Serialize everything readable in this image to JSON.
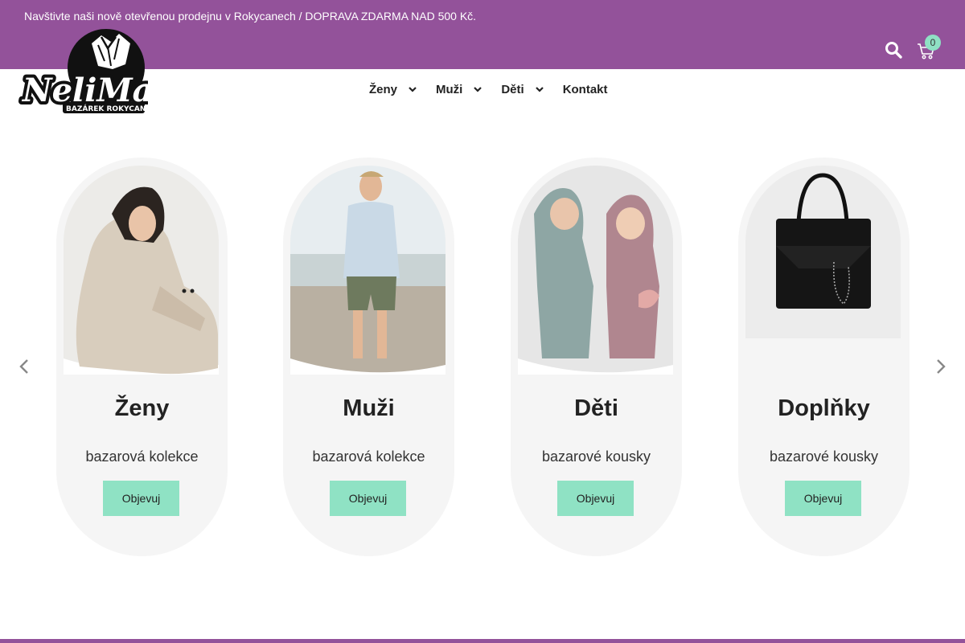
{
  "announcement": "Navštivte naši nově otevřenou prodejnu v Rokycanech / DOPRAVA ZDARMA NAD 500 Kč.",
  "logo": {
    "text": "NeliMax",
    "tagline": "BAZÁREK ROKYCANY"
  },
  "header": {
    "search_icon": "search-icon",
    "cart_icon": "cart-icon",
    "cart_count": "0"
  },
  "nav": [
    {
      "label": "Ženy",
      "has_dropdown": true
    },
    {
      "label": "Muži",
      "has_dropdown": true
    },
    {
      "label": "Děti",
      "has_dropdown": true
    },
    {
      "label": "Kontakt",
      "has_dropdown": false
    }
  ],
  "carousel": {
    "prev_icon": "chevron-left-icon",
    "next_icon": "chevron-right-icon",
    "cards": [
      {
        "title": "Ženy",
        "subtitle": "bazarová kolekce",
        "button": "Objevuj"
      },
      {
        "title": "Muži",
        "subtitle": "bazarová kolekce",
        "button": "Objevuj"
      },
      {
        "title": "Děti",
        "subtitle": "bazarové kousky",
        "button": "Objevuj"
      },
      {
        "title": "Doplňky",
        "subtitle": "bazarové kousky",
        "button": "Objevuj"
      }
    ]
  },
  "colors": {
    "brand_purple": "#93529a",
    "accent_mint": "#8fe2c4",
    "card_bg": "#f5f5f5"
  }
}
